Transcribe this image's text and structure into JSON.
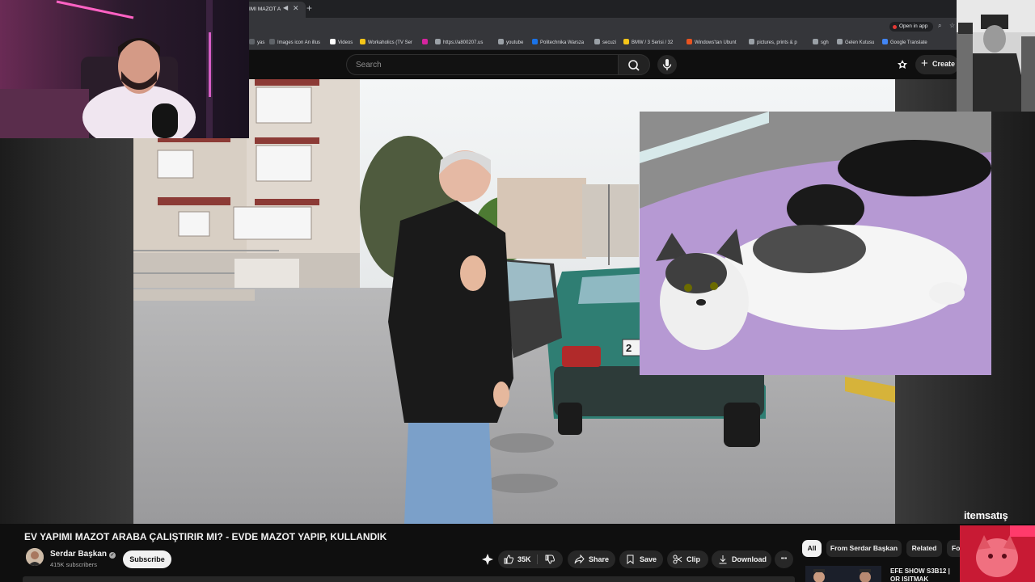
{
  "browser": {
    "tab_title": "IMI MAZOT A",
    "new_tab_label": "+",
    "open_in_app": "Open in app",
    "bookmarks": [
      {
        "label": "yas",
        "color": "#5f6368"
      },
      {
        "label": "Images icon An illus",
        "color": "#5f6368"
      },
      {
        "label": "Videos",
        "color": "#ffffff"
      },
      {
        "label": "Workaholics (TV Ser",
        "color": "#f5c518"
      },
      {
        "label": "https://a800207.us",
        "color": "#9aa0a6"
      },
      {
        "label": "",
        "color": "#d6249f"
      },
      {
        "label": "youtube",
        "color": "#9aa0a6"
      },
      {
        "label": "Politechnika Warsza",
        "color": "#1a73e8"
      },
      {
        "label": "secuzi",
        "color": "#9aa0a6"
      },
      {
        "label": "BMW / 3 Serisi / 32",
        "color": "#f5c518"
      },
      {
        "label": "Windows'tan Ubunt",
        "color": "#e95420"
      },
      {
        "label": "pictures, prints & p",
        "color": "#9aa0a6"
      },
      {
        "label": "sgh",
        "color": "#9aa0a6"
      },
      {
        "label": "Gelen Kutusu",
        "color": "#9aa0a6"
      },
      {
        "label": "Google Translate",
        "color": "#4285f4"
      }
    ]
  },
  "header": {
    "search_placeholder": "Search",
    "create_label": "Create"
  },
  "video": {
    "title": "EV YAPIMI MAZOT ARABA ÇALIŞTIRIR MI? - EVDE MAZOT YAPIP, KULLANDIK",
    "plate_fragment": "2",
    "watermark": "itemsatış"
  },
  "channel": {
    "name": "Serdar Başkan",
    "subscribers": "415K subscribers",
    "subscribe_label": "Subscribe"
  },
  "actions": {
    "likes": "35K",
    "share": "Share",
    "save": "Save",
    "clip": "Clip",
    "download": "Download",
    "more": "•••"
  },
  "chips": [
    "All",
    "From Serdar Başkan",
    "Related",
    "Fo"
  ],
  "recommendation": {
    "title": "EFE SHOW S3B12 | OR ISITMAK"
  },
  "colors": {
    "background": "#0f0f0f",
    "pill": "#272727",
    "text": "#f1f1f1",
    "secondary_text": "#aaaaaa",
    "accent_red": "#e53935"
  }
}
